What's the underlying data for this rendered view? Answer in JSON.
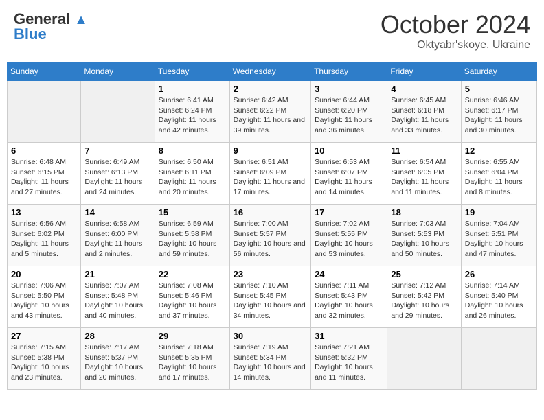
{
  "header": {
    "logo_line1": "General",
    "logo_line2": "Blue",
    "month": "October 2024",
    "location": "Oktyabr'skoye, Ukraine"
  },
  "days_of_week": [
    "Sunday",
    "Monday",
    "Tuesday",
    "Wednesday",
    "Thursday",
    "Friday",
    "Saturday"
  ],
  "weeks": [
    [
      {
        "day": "",
        "sunrise": "",
        "sunset": "",
        "daylight": "",
        "empty": true
      },
      {
        "day": "",
        "sunrise": "",
        "sunset": "",
        "daylight": "",
        "empty": true
      },
      {
        "day": "1",
        "sunrise": "Sunrise: 6:41 AM",
        "sunset": "Sunset: 6:24 PM",
        "daylight": "Daylight: 11 hours and 42 minutes."
      },
      {
        "day": "2",
        "sunrise": "Sunrise: 6:42 AM",
        "sunset": "Sunset: 6:22 PM",
        "daylight": "Daylight: 11 hours and 39 minutes."
      },
      {
        "day": "3",
        "sunrise": "Sunrise: 6:44 AM",
        "sunset": "Sunset: 6:20 PM",
        "daylight": "Daylight: 11 hours and 36 minutes."
      },
      {
        "day": "4",
        "sunrise": "Sunrise: 6:45 AM",
        "sunset": "Sunset: 6:18 PM",
        "daylight": "Daylight: 11 hours and 33 minutes."
      },
      {
        "day": "5",
        "sunrise": "Sunrise: 6:46 AM",
        "sunset": "Sunset: 6:17 PM",
        "daylight": "Daylight: 11 hours and 30 minutes."
      }
    ],
    [
      {
        "day": "6",
        "sunrise": "Sunrise: 6:48 AM",
        "sunset": "Sunset: 6:15 PM",
        "daylight": "Daylight: 11 hours and 27 minutes."
      },
      {
        "day": "7",
        "sunrise": "Sunrise: 6:49 AM",
        "sunset": "Sunset: 6:13 PM",
        "daylight": "Daylight: 11 hours and 24 minutes."
      },
      {
        "day": "8",
        "sunrise": "Sunrise: 6:50 AM",
        "sunset": "Sunset: 6:11 PM",
        "daylight": "Daylight: 11 hours and 20 minutes."
      },
      {
        "day": "9",
        "sunrise": "Sunrise: 6:51 AM",
        "sunset": "Sunset: 6:09 PM",
        "daylight": "Daylight: 11 hours and 17 minutes."
      },
      {
        "day": "10",
        "sunrise": "Sunrise: 6:53 AM",
        "sunset": "Sunset: 6:07 PM",
        "daylight": "Daylight: 11 hours and 14 minutes."
      },
      {
        "day": "11",
        "sunrise": "Sunrise: 6:54 AM",
        "sunset": "Sunset: 6:05 PM",
        "daylight": "Daylight: 11 hours and 11 minutes."
      },
      {
        "day": "12",
        "sunrise": "Sunrise: 6:55 AM",
        "sunset": "Sunset: 6:04 PM",
        "daylight": "Daylight: 11 hours and 8 minutes."
      }
    ],
    [
      {
        "day": "13",
        "sunrise": "Sunrise: 6:56 AM",
        "sunset": "Sunset: 6:02 PM",
        "daylight": "Daylight: 11 hours and 5 minutes."
      },
      {
        "day": "14",
        "sunrise": "Sunrise: 6:58 AM",
        "sunset": "Sunset: 6:00 PM",
        "daylight": "Daylight: 11 hours and 2 minutes."
      },
      {
        "day": "15",
        "sunrise": "Sunrise: 6:59 AM",
        "sunset": "Sunset: 5:58 PM",
        "daylight": "Daylight: 10 hours and 59 minutes."
      },
      {
        "day": "16",
        "sunrise": "Sunrise: 7:00 AM",
        "sunset": "Sunset: 5:57 PM",
        "daylight": "Daylight: 10 hours and 56 minutes."
      },
      {
        "day": "17",
        "sunrise": "Sunrise: 7:02 AM",
        "sunset": "Sunset: 5:55 PM",
        "daylight": "Daylight: 10 hours and 53 minutes."
      },
      {
        "day": "18",
        "sunrise": "Sunrise: 7:03 AM",
        "sunset": "Sunset: 5:53 PM",
        "daylight": "Daylight: 10 hours and 50 minutes."
      },
      {
        "day": "19",
        "sunrise": "Sunrise: 7:04 AM",
        "sunset": "Sunset: 5:51 PM",
        "daylight": "Daylight: 10 hours and 47 minutes."
      }
    ],
    [
      {
        "day": "20",
        "sunrise": "Sunrise: 7:06 AM",
        "sunset": "Sunset: 5:50 PM",
        "daylight": "Daylight: 10 hours and 43 minutes."
      },
      {
        "day": "21",
        "sunrise": "Sunrise: 7:07 AM",
        "sunset": "Sunset: 5:48 PM",
        "daylight": "Daylight: 10 hours and 40 minutes."
      },
      {
        "day": "22",
        "sunrise": "Sunrise: 7:08 AM",
        "sunset": "Sunset: 5:46 PM",
        "daylight": "Daylight: 10 hours and 37 minutes."
      },
      {
        "day": "23",
        "sunrise": "Sunrise: 7:10 AM",
        "sunset": "Sunset: 5:45 PM",
        "daylight": "Daylight: 10 hours and 34 minutes."
      },
      {
        "day": "24",
        "sunrise": "Sunrise: 7:11 AM",
        "sunset": "Sunset: 5:43 PM",
        "daylight": "Daylight: 10 hours and 32 minutes."
      },
      {
        "day": "25",
        "sunrise": "Sunrise: 7:12 AM",
        "sunset": "Sunset: 5:42 PM",
        "daylight": "Daylight: 10 hours and 29 minutes."
      },
      {
        "day": "26",
        "sunrise": "Sunrise: 7:14 AM",
        "sunset": "Sunset: 5:40 PM",
        "daylight": "Daylight: 10 hours and 26 minutes."
      }
    ],
    [
      {
        "day": "27",
        "sunrise": "Sunrise: 7:15 AM",
        "sunset": "Sunset: 5:38 PM",
        "daylight": "Daylight: 10 hours and 23 minutes."
      },
      {
        "day": "28",
        "sunrise": "Sunrise: 7:17 AM",
        "sunset": "Sunset: 5:37 PM",
        "daylight": "Daylight: 10 hours and 20 minutes."
      },
      {
        "day": "29",
        "sunrise": "Sunrise: 7:18 AM",
        "sunset": "Sunset: 5:35 PM",
        "daylight": "Daylight: 10 hours and 17 minutes."
      },
      {
        "day": "30",
        "sunrise": "Sunrise: 7:19 AM",
        "sunset": "Sunset: 5:34 PM",
        "daylight": "Daylight: 10 hours and 14 minutes."
      },
      {
        "day": "31",
        "sunrise": "Sunrise: 7:21 AM",
        "sunset": "Sunset: 5:32 PM",
        "daylight": "Daylight: 10 hours and 11 minutes."
      },
      {
        "day": "",
        "sunrise": "",
        "sunset": "",
        "daylight": "",
        "empty": true
      },
      {
        "day": "",
        "sunrise": "",
        "sunset": "",
        "daylight": "",
        "empty": true
      }
    ]
  ]
}
